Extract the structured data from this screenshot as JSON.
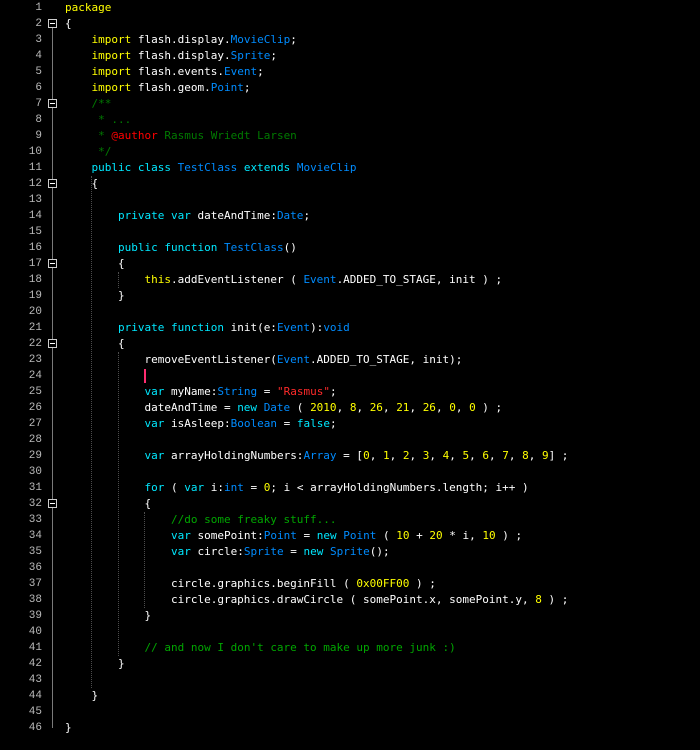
{
  "editor": {
    "language": "ActionScript 3",
    "colors": {
      "background": "#000000",
      "line_number": "#b9b9b9",
      "keyword": "#ffff00",
      "declaration": "#00e8ff",
      "type": "#008cff",
      "number": "#ffff00",
      "string": "#ff2a2a",
      "comment": "#00a600",
      "doc_comment": "#007a00",
      "doc_tag": "#ff0000",
      "plain": "#ffffff",
      "caret": "#ff2c70"
    },
    "fold_markers_on_lines": [
      2,
      7,
      12,
      17,
      22,
      32
    ],
    "caret_line": 24,
    "lines": [
      {
        "n": "1",
        "t": [
          [
            "kw",
            "package"
          ]
        ]
      },
      {
        "n": "2",
        "t": [
          [
            "text",
            "{"
          ]
        ]
      },
      {
        "n": "3",
        "t": [
          [
            "text",
            "    "
          ],
          [
            "kw",
            "import"
          ],
          [
            "text",
            " flash.display."
          ],
          [
            "type",
            "MovieClip"
          ],
          [
            "text",
            ";"
          ]
        ]
      },
      {
        "n": "4",
        "t": [
          [
            "text",
            "    "
          ],
          [
            "kw",
            "import"
          ],
          [
            "text",
            " flash.display."
          ],
          [
            "type",
            "Sprite"
          ],
          [
            "text",
            ";"
          ]
        ]
      },
      {
        "n": "5",
        "t": [
          [
            "text",
            "    "
          ],
          [
            "kw",
            "import"
          ],
          [
            "text",
            " flash.events."
          ],
          [
            "type",
            "Event"
          ],
          [
            "text",
            ";"
          ]
        ]
      },
      {
        "n": "6",
        "t": [
          [
            "text",
            "    "
          ],
          [
            "kw",
            "import"
          ],
          [
            "text",
            " flash.geom."
          ],
          [
            "type",
            "Point"
          ],
          [
            "text",
            ";"
          ]
        ]
      },
      {
        "n": "7",
        "t": [
          [
            "text",
            "    "
          ],
          [
            "doc",
            "/**"
          ]
        ]
      },
      {
        "n": "8",
        "t": [
          [
            "text",
            "     "
          ],
          [
            "doc",
            "* ..."
          ]
        ]
      },
      {
        "n": "9",
        "t": [
          [
            "text",
            "     "
          ],
          [
            "doc",
            "* "
          ],
          [
            "doctag",
            "@author"
          ],
          [
            "doc",
            " Rasmus Wriedt Larsen"
          ]
        ]
      },
      {
        "n": "10",
        "t": [
          [
            "text",
            "     "
          ],
          [
            "doc",
            "*/"
          ]
        ]
      },
      {
        "n": "11",
        "t": [
          [
            "text",
            "    "
          ],
          [
            "decl",
            "public"
          ],
          [
            "text",
            " "
          ],
          [
            "decl",
            "class"
          ],
          [
            "text",
            " "
          ],
          [
            "type",
            "TestClass"
          ],
          [
            "text",
            " "
          ],
          [
            "decl",
            "extends"
          ],
          [
            "text",
            " "
          ],
          [
            "type",
            "MovieClip"
          ]
        ]
      },
      {
        "n": "12",
        "t": [
          [
            "text",
            "    {"
          ]
        ]
      },
      {
        "n": "13",
        "t": [
          [
            "text",
            ""
          ]
        ]
      },
      {
        "n": "14",
        "t": [
          [
            "text",
            "        "
          ],
          [
            "decl",
            "private"
          ],
          [
            "text",
            " "
          ],
          [
            "decl",
            "var"
          ],
          [
            "text",
            " dateAndTime:"
          ],
          [
            "type",
            "Date"
          ],
          [
            "text",
            ";"
          ]
        ]
      },
      {
        "n": "15",
        "t": [
          [
            "text",
            ""
          ]
        ]
      },
      {
        "n": "16",
        "t": [
          [
            "text",
            "        "
          ],
          [
            "decl",
            "public"
          ],
          [
            "text",
            " "
          ],
          [
            "decl",
            "function"
          ],
          [
            "text",
            " "
          ],
          [
            "type",
            "TestClass"
          ],
          [
            "text",
            "()"
          ]
        ]
      },
      {
        "n": "17",
        "t": [
          [
            "text",
            "        {"
          ]
        ]
      },
      {
        "n": "18",
        "t": [
          [
            "text",
            "            "
          ],
          [
            "kw",
            "this"
          ],
          [
            "text",
            ".addEventListener ( "
          ],
          [
            "type",
            "Event"
          ],
          [
            "text",
            ".ADDED_TO_STAGE, init ) ;"
          ]
        ]
      },
      {
        "n": "19",
        "t": [
          [
            "text",
            "        }"
          ]
        ]
      },
      {
        "n": "20",
        "t": [
          [
            "text",
            ""
          ]
        ]
      },
      {
        "n": "21",
        "t": [
          [
            "text",
            "        "
          ],
          [
            "decl",
            "private"
          ],
          [
            "text",
            " "
          ],
          [
            "decl",
            "function"
          ],
          [
            "text",
            " init(e:"
          ],
          [
            "type",
            "Event"
          ],
          [
            "text",
            "):"
          ],
          [
            "type",
            "void"
          ]
        ]
      },
      {
        "n": "22",
        "t": [
          [
            "text",
            "        {"
          ]
        ]
      },
      {
        "n": "23",
        "t": [
          [
            "text",
            "            removeEventListener("
          ],
          [
            "type",
            "Event"
          ],
          [
            "text",
            ".ADDED_TO_STAGE, init);"
          ]
        ]
      },
      {
        "n": "24",
        "t": [
          [
            "text",
            ""
          ]
        ]
      },
      {
        "n": "25",
        "t": [
          [
            "text",
            "            "
          ],
          [
            "decl",
            "var"
          ],
          [
            "text",
            " myName:"
          ],
          [
            "type",
            "String"
          ],
          [
            "text",
            " = "
          ],
          [
            "str",
            "\"Rasmus\""
          ],
          [
            "text",
            ";"
          ]
        ]
      },
      {
        "n": "26",
        "t": [
          [
            "text",
            "            dateAndTime = "
          ],
          [
            "decl",
            "new"
          ],
          [
            "text",
            " "
          ],
          [
            "type",
            "Date"
          ],
          [
            "text",
            " ( "
          ],
          [
            "num",
            "2010"
          ],
          [
            "text",
            ", "
          ],
          [
            "num",
            "8"
          ],
          [
            "text",
            ", "
          ],
          [
            "num",
            "26"
          ],
          [
            "text",
            ", "
          ],
          [
            "num",
            "21"
          ],
          [
            "text",
            ", "
          ],
          [
            "num",
            "26"
          ],
          [
            "text",
            ", "
          ],
          [
            "num",
            "0"
          ],
          [
            "text",
            ", "
          ],
          [
            "num",
            "0"
          ],
          [
            "text",
            " ) ;"
          ]
        ]
      },
      {
        "n": "27",
        "t": [
          [
            "text",
            "            "
          ],
          [
            "decl",
            "var"
          ],
          [
            "text",
            " isAsleep:"
          ],
          [
            "type",
            "Boolean"
          ],
          [
            "text",
            " = "
          ],
          [
            "decl",
            "false"
          ],
          [
            "text",
            ";"
          ]
        ]
      },
      {
        "n": "28",
        "t": [
          [
            "text",
            ""
          ]
        ]
      },
      {
        "n": "29",
        "t": [
          [
            "text",
            "            "
          ],
          [
            "decl",
            "var"
          ],
          [
            "text",
            " arrayHoldingNumbers:"
          ],
          [
            "type",
            "Array"
          ],
          [
            "text",
            " = ["
          ],
          [
            "num",
            "0"
          ],
          [
            "text",
            ", "
          ],
          [
            "num",
            "1"
          ],
          [
            "text",
            ", "
          ],
          [
            "num",
            "2"
          ],
          [
            "text",
            ", "
          ],
          [
            "num",
            "3"
          ],
          [
            "text",
            ", "
          ],
          [
            "num",
            "4"
          ],
          [
            "text",
            ", "
          ],
          [
            "num",
            "5"
          ],
          [
            "text",
            ", "
          ],
          [
            "num",
            "6"
          ],
          [
            "text",
            ", "
          ],
          [
            "num",
            "7"
          ],
          [
            "text",
            ", "
          ],
          [
            "num",
            "8"
          ],
          [
            "text",
            ", "
          ],
          [
            "num",
            "9"
          ],
          [
            "text",
            "] ;"
          ]
        ]
      },
      {
        "n": "30",
        "t": [
          [
            "text",
            ""
          ]
        ]
      },
      {
        "n": "31",
        "t": [
          [
            "text",
            "            "
          ],
          [
            "decl",
            "for"
          ],
          [
            "text",
            " ( "
          ],
          [
            "decl",
            "var"
          ],
          [
            "text",
            " i:"
          ],
          [
            "type",
            "int"
          ],
          [
            "text",
            " = "
          ],
          [
            "num",
            "0"
          ],
          [
            "text",
            "; i < arrayHoldingNumbers.length; i++ )"
          ]
        ]
      },
      {
        "n": "32",
        "t": [
          [
            "text",
            "            {"
          ]
        ]
      },
      {
        "n": "33",
        "t": [
          [
            "text",
            "                "
          ],
          [
            "cmt",
            "//do some freaky stuff..."
          ]
        ]
      },
      {
        "n": "34",
        "t": [
          [
            "text",
            "                "
          ],
          [
            "decl",
            "var"
          ],
          [
            "text",
            " somePoint:"
          ],
          [
            "type",
            "Point"
          ],
          [
            "text",
            " = "
          ],
          [
            "decl",
            "new"
          ],
          [
            "text",
            " "
          ],
          [
            "type",
            "Point"
          ],
          [
            "text",
            " ( "
          ],
          [
            "num",
            "10"
          ],
          [
            "text",
            " + "
          ],
          [
            "num",
            "20"
          ],
          [
            "text",
            " * i, "
          ],
          [
            "num",
            "10"
          ],
          [
            "text",
            " ) ;"
          ]
        ]
      },
      {
        "n": "35",
        "t": [
          [
            "text",
            "                "
          ],
          [
            "decl",
            "var"
          ],
          [
            "text",
            " circle:"
          ],
          [
            "type",
            "Sprite"
          ],
          [
            "text",
            " = "
          ],
          [
            "decl",
            "new"
          ],
          [
            "text",
            " "
          ],
          [
            "type",
            "Sprite"
          ],
          [
            "text",
            "();"
          ]
        ]
      },
      {
        "n": "36",
        "t": [
          [
            "text",
            ""
          ]
        ]
      },
      {
        "n": "37",
        "t": [
          [
            "text",
            "                circle.graphics.beginFill ( "
          ],
          [
            "num",
            "0x00FF00"
          ],
          [
            "text",
            " ) ;"
          ]
        ]
      },
      {
        "n": "38",
        "t": [
          [
            "text",
            "                circle.graphics.drawCircle ( somePoint.x, somePoint.y, "
          ],
          [
            "num",
            "8"
          ],
          [
            "text",
            " ) ;"
          ]
        ]
      },
      {
        "n": "39",
        "t": [
          [
            "text",
            "            }"
          ]
        ]
      },
      {
        "n": "40",
        "t": [
          [
            "text",
            ""
          ]
        ]
      },
      {
        "n": "41",
        "t": [
          [
            "text",
            "            "
          ],
          [
            "cmt",
            "// and now I don't care to make up more junk :)"
          ]
        ]
      },
      {
        "n": "42",
        "t": [
          [
            "text",
            "        }"
          ]
        ]
      },
      {
        "n": "43",
        "t": [
          [
            "text",
            ""
          ]
        ]
      },
      {
        "n": "44",
        "t": [
          [
            "text",
            "    }"
          ]
        ]
      },
      {
        "n": "45",
        "t": [
          [
            "text",
            ""
          ]
        ]
      },
      {
        "n": "46",
        "t": [
          [
            "text",
            "}"
          ]
        ]
      }
    ]
  }
}
